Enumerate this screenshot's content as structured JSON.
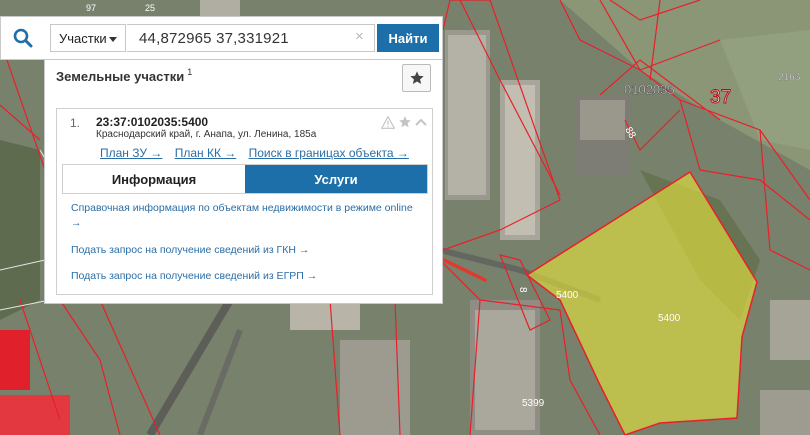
{
  "search": {
    "type_select": "Участки",
    "query": "44,872965 37,331921",
    "clear": "×",
    "find_label": "Найти"
  },
  "panel": {
    "title": "Земельные участки",
    "count": "1"
  },
  "result": {
    "number": "1.",
    "cadastral_id": "23:37:0102035:5400",
    "address": "Краснодарский край, г. Анапа, ул. Ленина, 185а",
    "links": [
      "План ЗУ →",
      "План КК →",
      "Поиск в границах объекта →"
    ]
  },
  "tabs": {
    "info": "Информация",
    "services": "Услуги"
  },
  "services": [
    "Справочная информация по объектам недвижимости в режиме online →",
    "Подать запрос на получение сведений из ГКН →",
    "Подать запрос на получение сведений из ЕГРП →"
  ],
  "map_labels": {
    "quarter": "0102035",
    "district": "37",
    "parcel_2163": "2163",
    "parcel_97": "97",
    "parcel_25": "25",
    "parcel_88": "88",
    "parcel_5400_small": "5400",
    "parcel_5400": "5400",
    "parcel_5399": "5399",
    "parcel_8": "8"
  },
  "colors": {
    "accent": "#1c6fa8",
    "link": "#2a6ea6",
    "boundary": "#e8202a",
    "highlight": "#e6e33a",
    "arrow": "#e03a30"
  }
}
